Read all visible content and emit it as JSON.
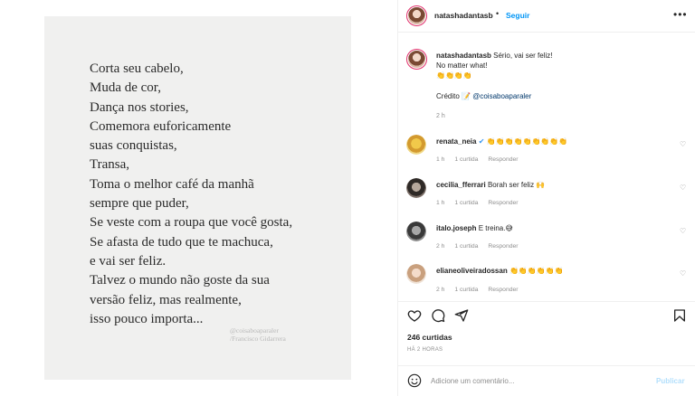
{
  "post": {
    "poem_lines": [
      "Corta seu cabelo,",
      "Muda de cor,",
      "Dança nos stories,",
      "Comemora euforicamente",
      "suas conquistas,",
      "Transa,",
      "Toma o melhor café da manhã",
      "sempre que puder,",
      "Se veste com a roupa que você gosta,",
      "Se afasta de tudo que te machuca,",
      "e vai ser feliz.",
      "Talvez o mundo não goste da sua",
      "versão feliz, mas realmente,",
      "isso pouco importa..."
    ],
    "watermark_handle": "@coisaboaparaler",
    "watermark_author": "/Francisco Gidarrera"
  },
  "header": {
    "username": "natashadantasb",
    "separator": "•",
    "follow_label": "Seguir",
    "more_icon": "more-options-icon"
  },
  "caption": {
    "username": "natashadantasb",
    "text": "Sério, vai ser feliz!",
    "line2": "No matter what!",
    "line3": "👏👏👏👏",
    "credit_label": "Crédito",
    "credit_emoji": "📝",
    "credit_link": "@coisaboaparaler",
    "time": "2 h"
  },
  "comments": [
    {
      "username": "renata_neia",
      "verified": "✔",
      "text": "👏👏👏👏👏👏👏👏👏",
      "time": "1 h",
      "likes": "1 curtida",
      "reply": "Responder"
    },
    {
      "username": "cecilia_fferrari",
      "text": "Borah ser feliz 🙌",
      "time": "1 h",
      "likes": "1 curtida",
      "reply": "Responder"
    },
    {
      "username": "italo.joseph",
      "text": "E treina.😅",
      "time": "2 h",
      "likes": "1 curtida",
      "reply": "Responder"
    },
    {
      "username": "elianeoliveiradossan",
      "text": "👏👏👏👏👏👏",
      "time": "2 h",
      "likes": "1 curtida",
      "reply": "Responder"
    }
  ],
  "actions": {
    "likes_count": "246 curtidas",
    "time_ago": "HÁ 2 HORAS",
    "icons": [
      "heart-icon",
      "comment-icon",
      "share-icon",
      "bookmark-icon"
    ]
  },
  "comment_box": {
    "placeholder": "Adicione um comentário...",
    "publish_label": "Publicar",
    "emoji_icon": "emoji-icon"
  },
  "colors": {
    "accent": "#0095f6",
    "story_ring": "#e1306c",
    "publish_disabled": "#b2dffc",
    "verified": "#3897f0"
  }
}
